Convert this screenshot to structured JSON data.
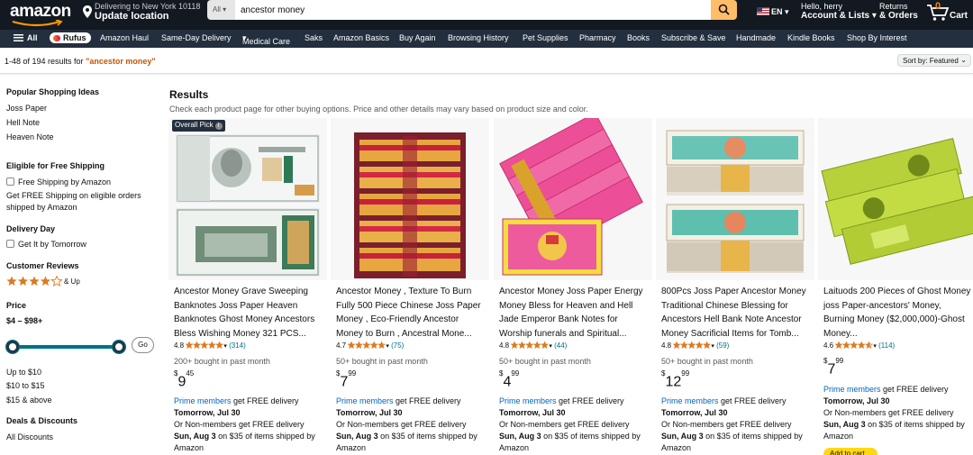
{
  "header": {
    "logo": "amazon",
    "deliver_line1": "Delivering to New York 10118",
    "deliver_line2": "Update location",
    "search_category": "All",
    "search_value": "ancestor money",
    "language": "EN",
    "account_line1": "Hello, herry",
    "account_line2": "Account & Lists",
    "returns_line1": "Returns",
    "returns_line2": "& Orders",
    "cart_count": "0",
    "cart_label": "Cart",
    "colors": {
      "nav_bg": "#131921",
      "subnav_bg": "#232f3e",
      "search_btn": "#febd69",
      "link": "#007185",
      "price_accent": "#c45500"
    }
  },
  "subnav": {
    "all": "All",
    "rufus": "Rufus",
    "items": [
      "Amazon Haul",
      "Same-Day Delivery",
      "Medical Care",
      "Saks",
      "Amazon Basics",
      "Buy Again",
      "Browsing History",
      "Pet Supplies",
      "Pharmacy",
      "Books",
      "Subscribe & Save",
      "Handmade",
      "Kindle Books",
      "Shop By Interest"
    ]
  },
  "results_bar": {
    "count_text": "1-48 of 194 results for ",
    "query": "\"ancestor money\"",
    "sort": "Sort by: Featured"
  },
  "sidebar": {
    "popular_heading": "Popular Shopping Ideas",
    "popular": [
      "Joss Paper",
      "Hell Note",
      "Heaven Note"
    ],
    "free_ship_heading": "Eligible for Free Shipping",
    "free_ship_option": "Free Shipping by Amazon",
    "free_ship_line1": "Get FREE Shipping on eligible orders",
    "free_ship_line2": "shipped by Amazon",
    "delivery_heading": "Delivery Day",
    "delivery_option": "Get It by Tomorrow",
    "reviews_heading": "Customer Reviews",
    "reviews_up": "& Up",
    "reviews_stars": 4,
    "price_heading": "Price",
    "price_range": "$4 – $98+",
    "go": "Go",
    "price_options": [
      "Up to $10",
      "$10 to $15",
      "$15 & above"
    ],
    "deals_heading": "Deals & Discounts",
    "deals_option": "All Discounts"
  },
  "results": {
    "title": "Results",
    "subtitle": "Check each product page for other buying options. Price and other details may vary based on product size and color.",
    "overall_pick": "Overall Pick",
    "add_to_cart": "Add to cart"
  },
  "products": [
    {
      "title": "Ancestor Money Grave Sweeping Banknotes Joss Paper Heaven Banknotes Ghost Money Ancestors Bless Wishing Money 321 PCS...",
      "rating": "4.8",
      "stars": 4.8,
      "reviews": "(314)",
      "bought": "200+ bought in past month",
      "price_dollars": "9",
      "price_cents": "45",
      "prime_link": "Prime members",
      "prime_text": " get FREE delivery",
      "prime_date": "Tomorrow, Jul 30",
      "nonmember_line": "Or Non-members get FREE delivery",
      "nonmember_date": "Sun, Aug 3",
      "nonmember_rest": " on $35 of items shipped by",
      "shipped_by": "Amazon"
    },
    {
      "title": "Ancestor Money , Texture To Burn Fully 500 Piece Chinese Joss Paper Money , Eco-Friendly Ancestor Money to Burn , Ancestral Mone...",
      "rating": "4.7",
      "stars": 4.7,
      "reviews": "(75)",
      "bought": "50+ bought in past month",
      "price_dollars": "7",
      "price_cents": "99",
      "prime_link": "Prime members",
      "prime_text": " get FREE delivery",
      "prime_date": "Tomorrow, Jul 30",
      "nonmember_line": "Or Non-members get FREE delivery",
      "nonmember_date": "Sun, Aug 3",
      "nonmember_rest": " on $35 of items shipped by",
      "shipped_by": "Amazon"
    },
    {
      "title": "Ancestor Money Joss Paper Energy Money Bless for Heaven and Hell Jade Emperor Bank Notes for Worship funerals and Spiritual...",
      "rating": "4.8",
      "stars": 4.8,
      "reviews": "(44)",
      "bought": "50+ bought in past month",
      "price_dollars": "4",
      "price_cents": "99",
      "prime_link": "Prime members",
      "prime_text": " get FREE delivery",
      "prime_date": "Tomorrow, Jul 30",
      "nonmember_line": "Or Non-members get FREE delivery",
      "nonmember_date": "Sun, Aug 3",
      "nonmember_rest": " on $35 of items shipped by",
      "shipped_by": "Amazon"
    },
    {
      "title": "800Pcs Joss Paper Ancestor Money Traditional Chinese Blessing for Ancestors Hell Bank Note Ancestor Money Sacrificial Items for Tomb...",
      "rating": "4.8",
      "stars": 4.8,
      "reviews": "(59)",
      "bought": "50+ bought in past month",
      "price_dollars": "12",
      "price_cents": "99",
      "prime_link": "Prime members",
      "prime_text": " get FREE delivery",
      "prime_date": "Tomorrow, Jul 30",
      "nonmember_line": "Or Non-members get FREE delivery",
      "nonmember_date": "Sun, Aug 3",
      "nonmember_rest": " on $35 of items shipped by",
      "shipped_by": "Amazon"
    },
    {
      "title": "Laituods 200 Pieces of Ghost Money joss Paper-ancestors' Money, Burning Money ($2,000,000)-Ghost Money...",
      "rating": "4.6",
      "stars": 4.6,
      "reviews": "(114)",
      "bought": "",
      "price_dollars": "7",
      "price_cents": "99",
      "prime_link": "Prime members",
      "prime_text": " get FREE delivery",
      "prime_date": "Tomorrow, Jul 30",
      "nonmember_line": "Or Non-members get FREE delivery",
      "nonmember_date": "Sun, Aug 3",
      "nonmember_rest": " on $35 of items shipped by",
      "shipped_by": "Amazon"
    }
  ]
}
